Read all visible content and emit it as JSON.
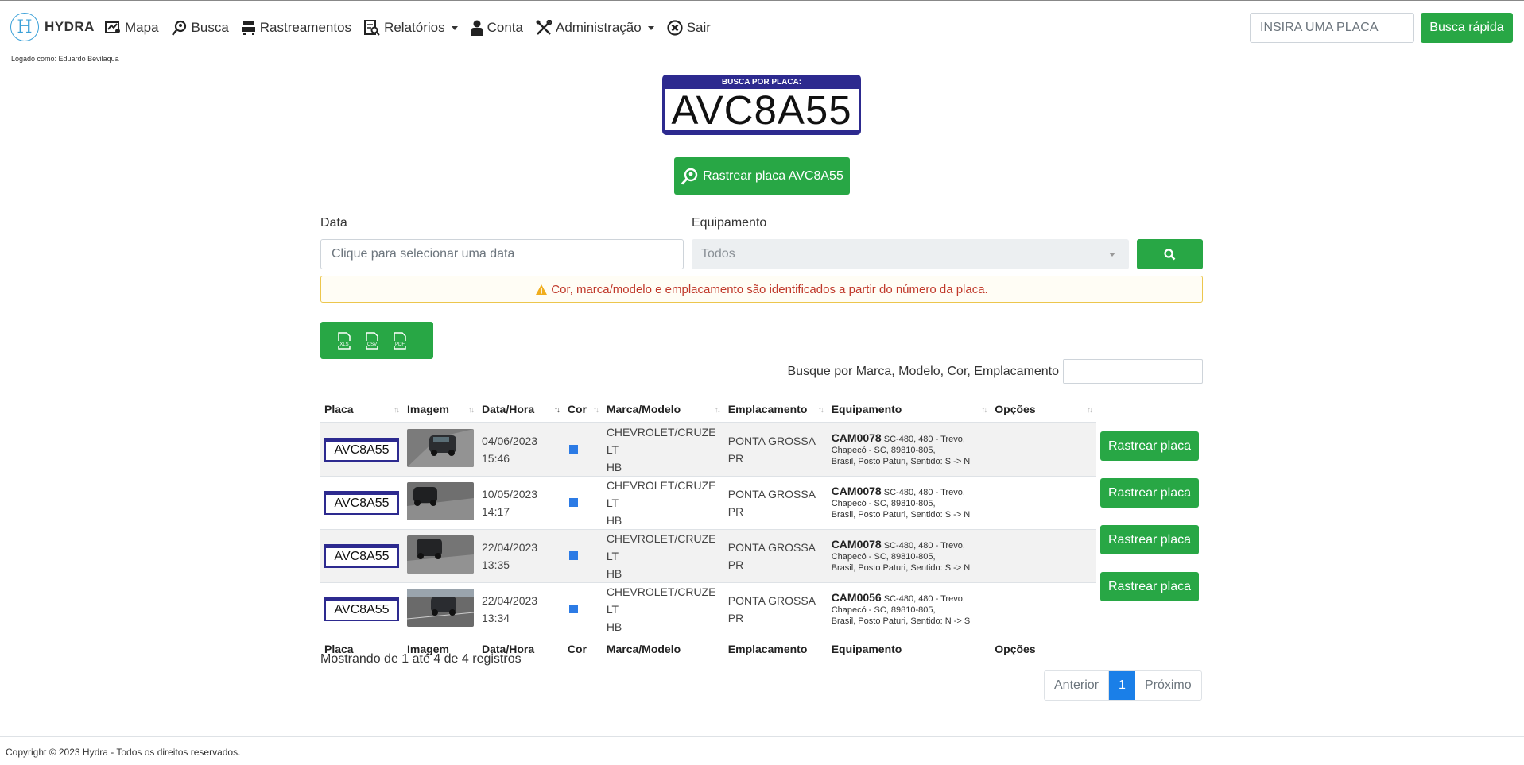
{
  "brand": {
    "logo_letter": "H",
    "name": "HYDRA"
  },
  "nav": [
    {
      "label": "Mapa",
      "icon": "map-icon"
    },
    {
      "label": "Busca",
      "icon": "search-pin-icon"
    },
    {
      "label": "Rastreamentos",
      "icon": "car-icon"
    },
    {
      "label": "Relatórios",
      "icon": "report-icon",
      "dropdown": true
    },
    {
      "label": "Conta",
      "icon": "user-icon"
    },
    {
      "label": "Administração",
      "icon": "tools-icon",
      "dropdown": true
    },
    {
      "label": "Sair",
      "icon": "close-circle-icon"
    }
  ],
  "logged_as": "Logado como: Eduardo Bevilaqua",
  "quick_search": {
    "placeholder": "INSIRA UMA PLACA",
    "button": "Busca rápida"
  },
  "plate_header": {
    "label": "BUSCA POR PLACA:",
    "value": "AVC8A55"
  },
  "track_button": "Rastrear placa AVC8A55",
  "filters": {
    "date_label": "Data",
    "date_placeholder": "Clique para selecionar uma data",
    "equip_label": "Equipamento",
    "equip_value": "Todos"
  },
  "alert": "Cor, marca/modelo e emplacamento são identificados a partir do número da placa.",
  "export": [
    "XLS",
    "CSV",
    "PDF"
  ],
  "table_filter_label": "Busque por Marca, Modelo, Cor, Emplacamento",
  "columns": [
    "Placa",
    "Imagem",
    "Data/Hora",
    "Cor",
    "Marca/Modelo",
    "Emplacamento",
    "Equipamento",
    "Opções"
  ],
  "rows": [
    {
      "placa": "AVC8A55",
      "data": "04/06/2023",
      "hora": "15:46",
      "cor": "#2c7be5",
      "marca_l1": "CHEVROLET/CRUZE LT",
      "marca_l2": "HB",
      "empl_l1": "PONTA GROSSA",
      "empl_l2": "PR",
      "equip_id": "CAM0078",
      "equip_l1": "SC-480, 480 - Trevo, Chapecó - SC, 89810-805,",
      "equip_l2": "Brasil, Posto Paturi, Sentido: S -> N",
      "action": "Rastrear placa"
    },
    {
      "placa": "AVC8A55",
      "data": "10/05/2023",
      "hora": "14:17",
      "cor": "#2c7be5",
      "marca_l1": "CHEVROLET/CRUZE LT",
      "marca_l2": "HB",
      "empl_l1": "PONTA GROSSA",
      "empl_l2": "PR",
      "equip_id": "CAM0078",
      "equip_l1": "SC-480, 480 - Trevo, Chapecó - SC, 89810-805,",
      "equip_l2": "Brasil, Posto Paturi, Sentido: S -> N",
      "action": "Rastrear placa"
    },
    {
      "placa": "AVC8A55",
      "data": "22/04/2023",
      "hora": "13:35",
      "cor": "#2c7be5",
      "marca_l1": "CHEVROLET/CRUZE LT",
      "marca_l2": "HB",
      "empl_l1": "PONTA GROSSA",
      "empl_l2": "PR",
      "equip_id": "CAM0078",
      "equip_l1": "SC-480, 480 - Trevo, Chapecó - SC, 89810-805,",
      "equip_l2": "Brasil, Posto Paturi, Sentido: S -> N",
      "action": "Rastrear placa"
    },
    {
      "placa": "AVC8A55",
      "data": "22/04/2023",
      "hora": "13:34",
      "cor": "#2c7be5",
      "marca_l1": "CHEVROLET/CRUZE LT",
      "marca_l2": "HB",
      "empl_l1": "PONTA GROSSA",
      "empl_l2": "PR",
      "equip_id": "CAM0056",
      "equip_l1": "SC-480, 480 - Trevo, Chapecó - SC, 89810-805,",
      "equip_l2": "Brasil, Posto Paturi, Sentido: N -> S",
      "action": "Rastrear placa"
    }
  ],
  "info": "Mostrando de 1 até 4 de 4 registros",
  "pagination": {
    "prev": "Anterior",
    "current": "1",
    "next": "Próximo"
  },
  "footer": "Copyright © 2023 Hydra - Todos os direitos reservados.",
  "colors": {
    "green": "#28a745",
    "plate_blue": "#2d2a8f",
    "page_blue": "#1a7fe8",
    "alert_border": "#ecc64d",
    "alert_text": "#c0392b"
  }
}
